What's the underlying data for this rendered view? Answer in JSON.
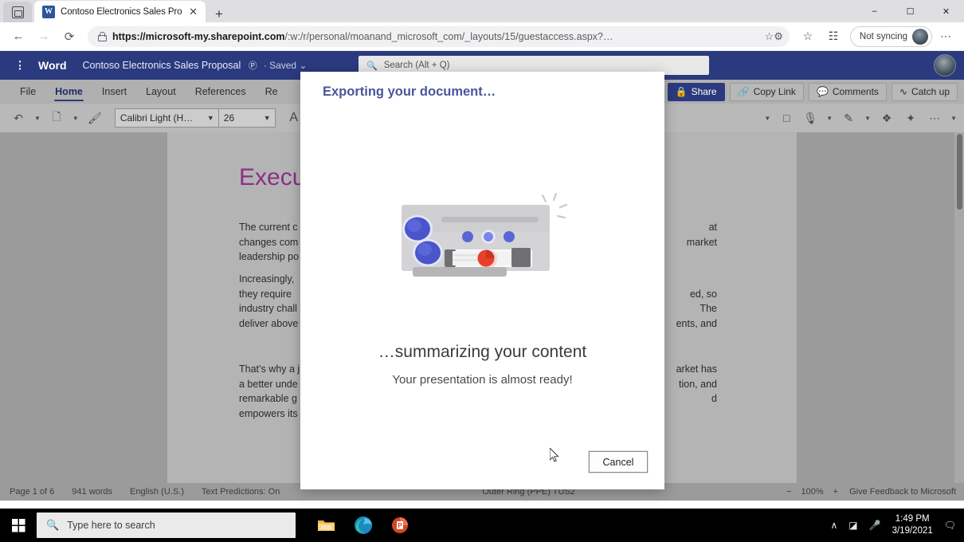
{
  "browser": {
    "tab": {
      "title": "Contoso Electronics Sales Propo",
      "favicon_letter": "W",
      "close_label": "✕"
    },
    "new_tab_label": "+",
    "window_controls": {
      "minimize": "–",
      "maximize": "☐",
      "close": "✕"
    },
    "nav": {
      "back": "←",
      "forward": "→",
      "reload": "⟳"
    },
    "url_bold": "https://microsoft-my.sharepoint.com",
    "url_rest": "/:w:/r/personal/moanand_microsoft_com/_layouts/15/guestaccess.aspx?…",
    "omnibox_trailing_icon": "favorite-settings-icon",
    "toolbar_icons": [
      "favorites-icon",
      "collections-icon"
    ],
    "sync_status": "Not syncing",
    "more_label": "⋯"
  },
  "word": {
    "brand": "Word",
    "document_title": "Contoso Electronics Sales Proposal",
    "share_person_glyph": "Ⓟ",
    "saved_status": "Saved",
    "search_placeholder": "Search (Alt + Q)",
    "ribbon_tabs": [
      {
        "label": "File",
        "active": false
      },
      {
        "label": "Home",
        "active": true
      },
      {
        "label": "Insert",
        "active": false
      },
      {
        "label": "Layout",
        "active": false
      },
      {
        "label": "References",
        "active": false
      },
      {
        "label": "Re",
        "active": false
      }
    ],
    "ribbon_actions": [
      {
        "label": "Share",
        "icon": "share-lock-icon",
        "primary": true
      },
      {
        "label": "Copy Link",
        "icon": "link-icon",
        "primary": false
      },
      {
        "label": "Comments",
        "icon": "comment-icon",
        "primary": false
      },
      {
        "label": "Catch up",
        "icon": "catch-up-icon",
        "primary": false
      }
    ],
    "toolbar": {
      "undo": "↶",
      "paste": "🗋",
      "format_painter": "🖌",
      "font_name": "Calibri Light (H…",
      "font_size": "26",
      "grow_font": "A",
      "shrink_font": "A",
      "more": "⋯"
    }
  },
  "document": {
    "heading": "Execu",
    "paragraphs": [
      {
        "left": [
          "The current c",
          "changes com",
          "leadership po"
        ],
        "right": [
          "at",
          "market",
          ""
        ]
      },
      {
        "left": [
          "Increasingly,",
          "they require",
          "industry chall",
          "deliver above"
        ],
        "right": [
          "ed, so",
          "The",
          "ents, and",
          ""
        ]
      },
      {
        "left": [
          "That’s why a j",
          "a better unde",
          "remarkable g",
          "empowers its"
        ],
        "right": [
          "arket has",
          "tion, and",
          "d",
          ""
        ]
      }
    ]
  },
  "status_bar": {
    "page": "Page 1 of 6",
    "words": "941 words",
    "language": "English (U.S.)",
    "predictions": "Text Predictions: On",
    "ring": "Outer Ring (PPE)  TUS2",
    "zoom_out": "−",
    "zoom_level": "100%",
    "zoom_in": "+",
    "feedback": "Give Feedback to Microsoft"
  },
  "dialog": {
    "title": "Exporting your document…",
    "illustration_name": "export-machine-illustration",
    "main_text": "…summarizing your content",
    "sub_text": "Your presentation is almost ready!",
    "cancel_label": "Cancel",
    "title_color": "#4a5699"
  },
  "taskbar": {
    "start_label": "windows-start-icon",
    "search_placeholder": "Type here to search",
    "apps": [
      {
        "name": "file-explorer-icon"
      },
      {
        "name": "microsoft-edge-icon"
      },
      {
        "name": "powerpoint-icon"
      }
    ],
    "tray": {
      "chevron": "∧",
      "network": "network-icon",
      "mic": "microphone-icon"
    },
    "time": "1:49 PM",
    "date": "3/19/2021",
    "notifications": "notification-icon"
  }
}
